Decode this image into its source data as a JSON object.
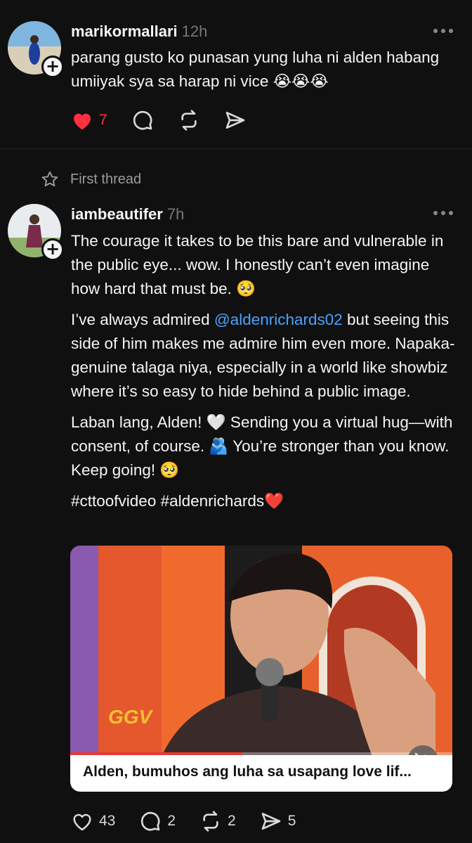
{
  "post1": {
    "username": "marikormallari",
    "time": "12h",
    "text": "parang gusto ko punasan yung luha ni alden habang umiiyak sya sa harap ni vice 😭😭😭",
    "likes": "7",
    "like_color": "#ff3040"
  },
  "thread_label": "First thread",
  "post2": {
    "username": "iambeautifer",
    "time": "7h",
    "para1": "The courage it takes to be this bare and vulnerable in the public eye... wow. I honestly can’t even imagine how hard that must be. 🥺",
    "para2_before": "I’ve always admired ",
    "mention": "@aldenrichards02",
    "para2_after": " but seeing this side of him makes me admire him even more. Napaka-genuine talaga niya, especially in a world like showbiz where it’s so easy to hide behind a public image.",
    "para3": "Laban lang, Alden! 🤍 Sending you a virtual hug—with consent, of course. 🫂 You’re stronger than you know. Keep going! 🥺",
    "hashtags": "#cttoofvideo #aldenrichards❤️",
    "video_caption": "Alden, bumuhos ang luha sa usapang love lif...",
    "video_logo": "GGV",
    "video_progress": 0.45,
    "likes": "43",
    "replies": "2",
    "reposts": "2",
    "shares": "5"
  },
  "colors": {
    "background": "#101010",
    "mention": "#4aa3ff"
  }
}
